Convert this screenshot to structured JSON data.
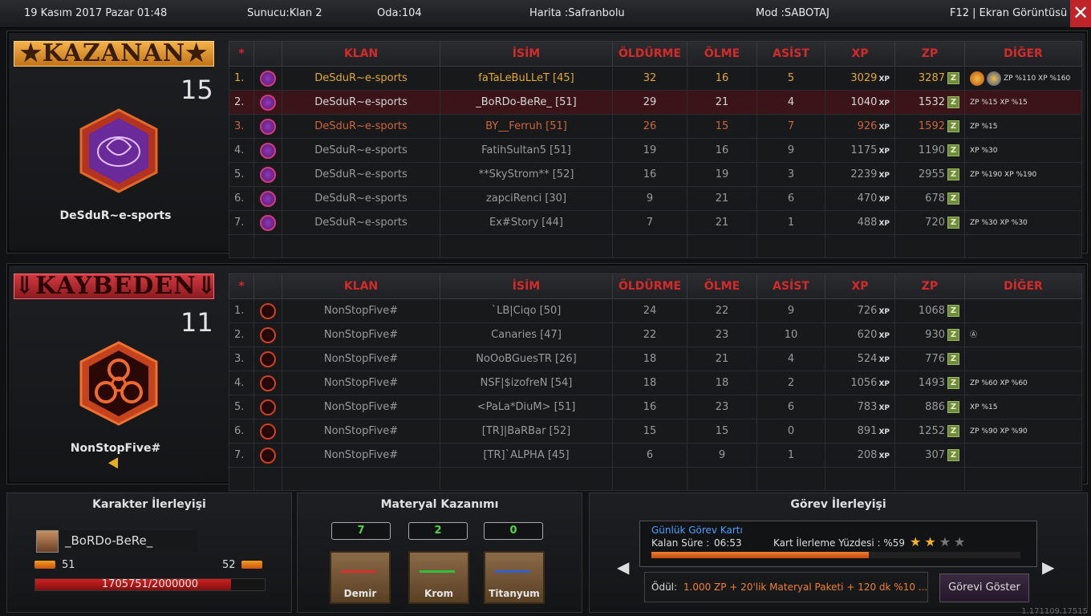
{
  "topbar": {
    "datetime": "19 Kasım 2017 Pazar 01:48",
    "server": "Sunucu:Klan 2",
    "room": "Oda:104",
    "map": "Harita :Safranbolu",
    "mode": "Mod :SABOTAJ",
    "screenshot": "F12 | Ekran Görüntüsü",
    "close": "✕"
  },
  "headers": {
    "star": "*",
    "clan": "KLAN",
    "name": "İSİM",
    "kills": "ÖLDÜRME",
    "deaths": "ÖLME",
    "assists": "ASİST",
    "xp": "XP",
    "zp": "ZP",
    "other": "DİĞER"
  },
  "winner": {
    "banner": "★KAZANAN★",
    "score": "15",
    "team": "DeSduR~e-sports",
    "rows": [
      {
        "n": "1.",
        "clan": "DeSduR~e-sports",
        "name": "faTaLeBuLLeT [45]",
        "kills": "32",
        "deaths": "16",
        "assists": "5",
        "xp": "3029",
        "zp": "3287",
        "style": "gold",
        "bonus": "ZP %110  XP %160"
      },
      {
        "n": "2.",
        "clan": "DeSduR~e-sports",
        "name": "_BoRDo-BeRe_ [51]",
        "kills": "29",
        "deaths": "21",
        "assists": "4",
        "xp": "1040",
        "zp": "1532",
        "style": "me",
        "bonus": "ZP %15  XP %15"
      },
      {
        "n": "3.",
        "clan": "DeSduR~e-sports",
        "name": "BY__Ferruh [51]",
        "kills": "26",
        "deaths": "15",
        "assists": "7",
        "xp": "926",
        "zp": "1592",
        "style": "orange",
        "bonus": "ZP %15"
      },
      {
        "n": "4.",
        "clan": "DeSduR~e-sports",
        "name": "FatihSultan5 [51]",
        "kills": "19",
        "deaths": "16",
        "assists": "9",
        "xp": "1175",
        "zp": "1190",
        "style": "",
        "bonus": "XP %30"
      },
      {
        "n": "5.",
        "clan": "DeSduR~e-sports",
        "name": "**SkyStrom** [52]",
        "kills": "16",
        "deaths": "19",
        "assists": "3",
        "xp": "2239",
        "zp": "2955",
        "style": "",
        "bonus": "ZP %190  XP %190"
      },
      {
        "n": "6.",
        "clan": "DeSduR~e-sports",
        "name": "zapciRenci [30]",
        "kills": "9",
        "deaths": "21",
        "assists": "6",
        "xp": "470",
        "zp": "678",
        "style": "",
        "bonus": ""
      },
      {
        "n": "7.",
        "clan": "DeSduR~e-sports",
        "name": "Ex#Story [44]",
        "kills": "7",
        "deaths": "21",
        "assists": "1",
        "xp": "488",
        "zp": "720",
        "style": "",
        "bonus": "ZP %30  XP %30"
      }
    ]
  },
  "loser": {
    "banner": "⇓KAYBEDEN⇓",
    "score": "11",
    "team": "NonStopFive#",
    "rows": [
      {
        "n": "1.",
        "clan": "NonStopFive#",
        "name": "`LB|Ciqo [50]",
        "kills": "24",
        "deaths": "22",
        "assists": "9",
        "xp": "726",
        "zp": "1068",
        "style": "",
        "bonus": ""
      },
      {
        "n": "2.",
        "clan": "NonStopFive#",
        "name": "Canaries [47]",
        "kills": "22",
        "deaths": "23",
        "assists": "10",
        "xp": "620",
        "zp": "930",
        "style": "",
        "bonus": "Ⓐ"
      },
      {
        "n": "3.",
        "clan": "NonStopFive#",
        "name": "NoOoBGuesTR [26]",
        "kills": "18",
        "deaths": "21",
        "assists": "4",
        "xp": "524",
        "zp": "776",
        "style": "",
        "bonus": ""
      },
      {
        "n": "4.",
        "clan": "NonStopFive#",
        "name": "NSF|$izofreN [54]",
        "kills": "18",
        "deaths": "18",
        "assists": "2",
        "xp": "1056",
        "zp": "1493",
        "style": "",
        "bonus": "ZP %60  XP %60"
      },
      {
        "n": "5.",
        "clan": "NonStopFive#",
        "name": "<PaLa*DiuM> [51]",
        "kills": "16",
        "deaths": "23",
        "assists": "6",
        "xp": "783",
        "zp": "886",
        "style": "",
        "bonus": "XP %15"
      },
      {
        "n": "6.",
        "clan": "NonStopFive#",
        "name": "[TR]|BaRBar [52]",
        "kills": "15",
        "deaths": "15",
        "assists": "0",
        "xp": "891",
        "zp": "1252",
        "style": "",
        "bonus": "ZP %90  XP %90"
      },
      {
        "n": "7.",
        "clan": "NonStopFive#",
        "name": "[TR]`ALPHA [45]",
        "kills": "6",
        "deaths": "9",
        "assists": "1",
        "xp": "208",
        "zp": "307",
        "style": "",
        "bonus": ""
      }
    ]
  },
  "character": {
    "title": "Karakter İlerleyişi",
    "name": "_BoRDo-BeRe_",
    "level_current": "51",
    "level_next": "52",
    "progress_text": "1705751/2000000",
    "progress_fraction": 0.853
  },
  "material": {
    "title": "Materyal Kazanımı",
    "items": [
      {
        "label": "Demir",
        "count": "7",
        "color": "#d43030"
      },
      {
        "label": "Krom",
        "count": "2",
        "color": "#30c040"
      },
      {
        "label": "Titanyum",
        "count": "0",
        "color": "#3060d0"
      }
    ]
  },
  "mission": {
    "title": "Görev İlerleyişi",
    "card_title": "Günlük Görev Kartı",
    "remaining_label": "Kalan Süre :",
    "remaining": "06:53",
    "progress_label": "Kart İlerleme Yüzdesi : %59",
    "progress_fraction": 0.59,
    "stars_filled": 2,
    "stars_total": 4,
    "reward_label": "Ödül:",
    "reward": "1.000 ZP + 20'lik Materyal Paketi + 120 dk %10 ...",
    "show_button": "Görevi Göster"
  },
  "version": "1.171109.17515"
}
